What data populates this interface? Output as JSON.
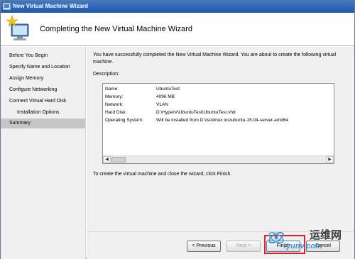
{
  "window": {
    "title": "New Virtual Machine Wizard",
    "icon": "wizard-icon"
  },
  "header": {
    "title": "Completing the New Virtual Machine Wizard",
    "icon": "computer-star-icon"
  },
  "nav": {
    "items": [
      {
        "label": "Before You Begin"
      },
      {
        "label": "Specify Name and Location"
      },
      {
        "label": "Assign Memory"
      },
      {
        "label": "Configure Networking"
      },
      {
        "label": "Connect Virtual Hard Disk"
      },
      {
        "label": "Installation Options"
      },
      {
        "label": "Summary",
        "selected": true
      }
    ]
  },
  "content": {
    "intro": "You have successfully completed the New Virtual Machine Wizard. You are about to create the following virtual machine.",
    "description_label": "Description:",
    "description": [
      {
        "key": "Name:",
        "value": "UbuntuTest"
      },
      {
        "key": "Memory:",
        "value": "4096 MB"
      },
      {
        "key": "Network:",
        "value": "VLAN"
      },
      {
        "key": "Hard Disk:",
        "value": "D:\\HyperV\\UbuntuTest\\UbuntuTest.vhd"
      },
      {
        "key": "Operating System:",
        "value": "Will be installed from D:\\iso\\linux ios\\ubuntu-15.04-server-amd64"
      }
    ],
    "finish_text": "To create the virtual machine and close the wizard, click Finish."
  },
  "buttons": {
    "previous": "< Previous",
    "next": "Next >",
    "finish": "Finish",
    "cancel": "Cancel"
  },
  "watermark": {
    "cn": "运维网",
    "url": "iyunv.com"
  },
  "colors": {
    "titlebar": "#2f68b8",
    "highlight": "#e02020",
    "nav_selected": "#c6c6c6"
  }
}
